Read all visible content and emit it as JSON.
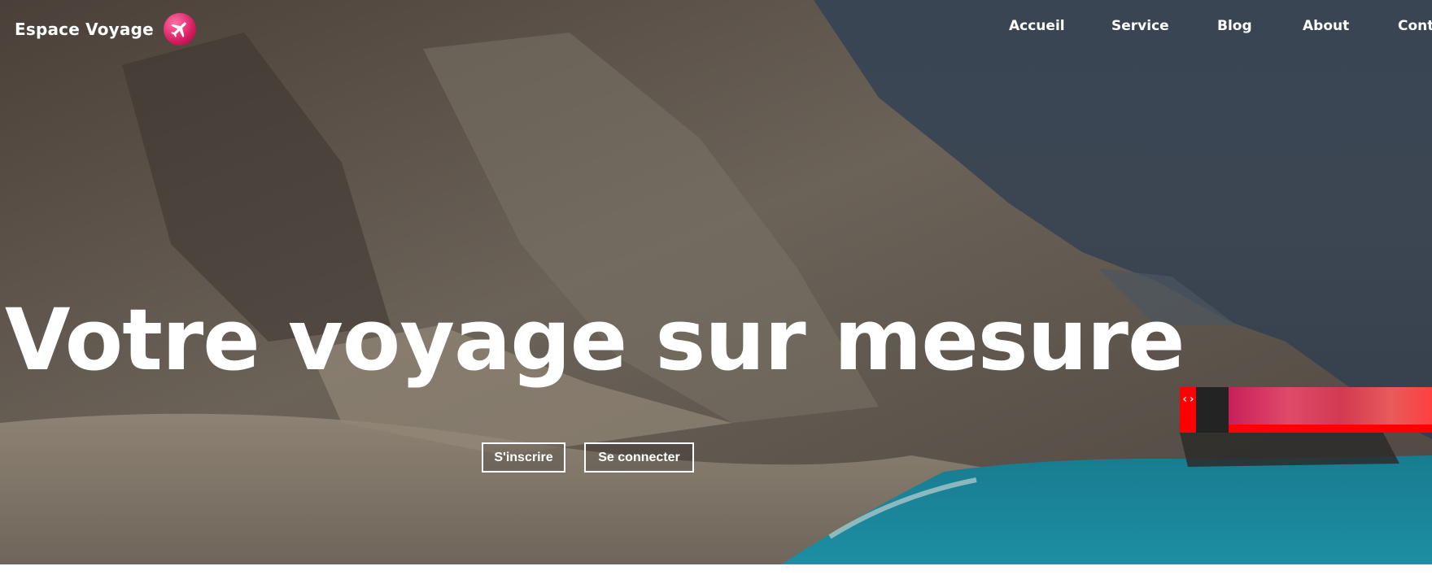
{
  "brand": {
    "name": "Espace Voyage",
    "logo_icon": "airplane-icon"
  },
  "nav": {
    "items": [
      "Accueil",
      "Service",
      "Blog",
      "About",
      "Cont"
    ]
  },
  "hero": {
    "headline": "Votre voyage sur mesure",
    "signup_label": "S'inscrire",
    "login_label": "Se connecter"
  },
  "widget": {
    "code_glyph": "‹›"
  },
  "colors": {
    "accent": "#ff0000",
    "logo": "#d81b60",
    "sea": "#1d8ea3",
    "sky": "#3a4554"
  }
}
